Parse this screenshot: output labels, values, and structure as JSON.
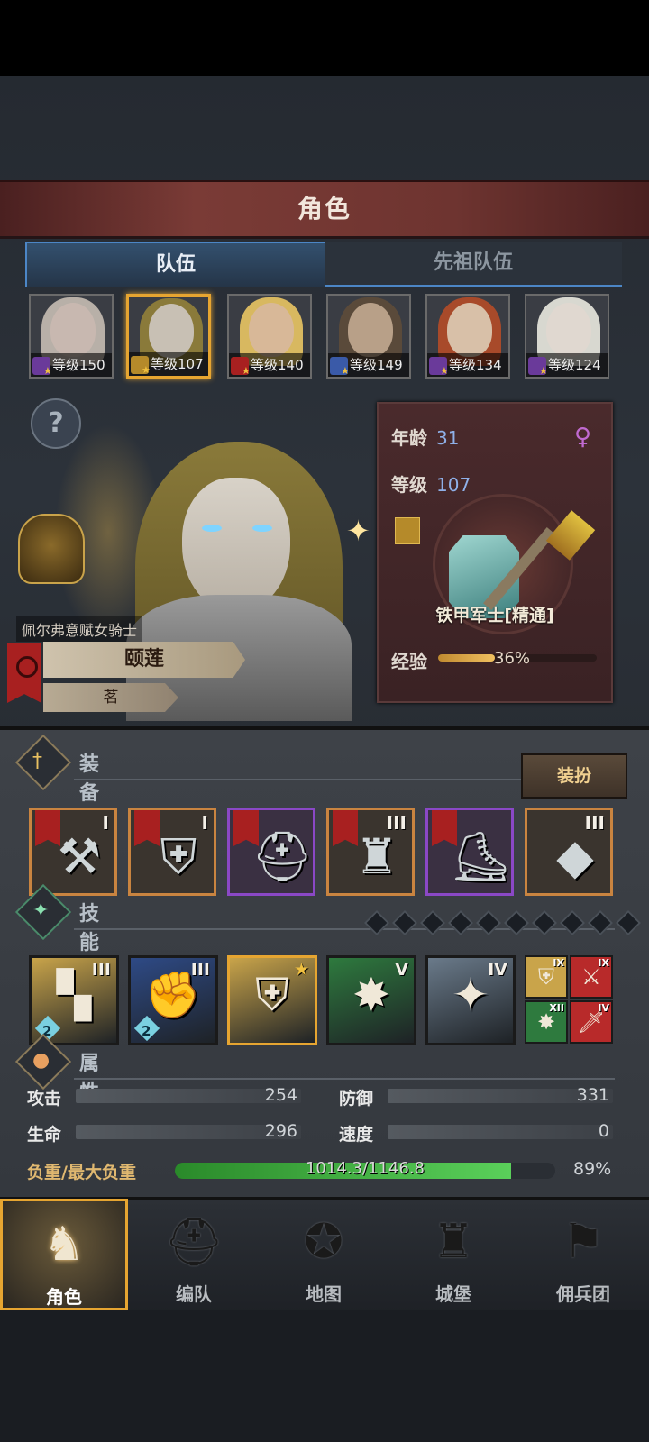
{
  "header": {
    "title": "角色"
  },
  "tabs": [
    {
      "label": "队伍",
      "active": true
    },
    {
      "label": "先祖队伍",
      "active": false
    }
  ],
  "heroes": [
    {
      "level_text": "等级150",
      "selected": false,
      "hair": "#b8b0a8",
      "face": "#c8b8b0",
      "class_color": "#6a3a9a"
    },
    {
      "level_text": "等级107",
      "selected": true,
      "hair": "#8a7a3a",
      "face": "#c8c0b4",
      "class_color": "#b58a2a"
    },
    {
      "level_text": "等级140",
      "selected": false,
      "hair": "#d8b860",
      "face": "#d8b898",
      "class_color": "#a82020"
    },
    {
      "level_text": "等级149",
      "selected": false,
      "hair": "#5a4a3a",
      "face": "#b8a088",
      "class_color": "#3a5aa8"
    },
    {
      "level_text": "等级134",
      "selected": false,
      "hair": "#a84a2a",
      "face": "#d8c0a8",
      "class_color": "#6a3a9a"
    },
    {
      "level_text": "等级124",
      "selected": false,
      "hair": "#d8d8d0",
      "face": "#e0d8d0",
      "class_color": "#6a3a9a"
    }
  ],
  "character": {
    "title": "佩尔弗意赋女骑士",
    "name": "颐莲",
    "tag": "茗",
    "age_label": "年龄",
    "age": "31",
    "level_label": "等级",
    "level": "107",
    "job": "铁甲军士[精通]",
    "exp_label": "经验",
    "exp_pct_text": "36%",
    "exp_fraction": 0.36
  },
  "equipment": {
    "title": "装备",
    "dress_button": "装扮",
    "items": [
      {
        "name": "war-hammer",
        "rank": "I",
        "border": "orange",
        "flag": true,
        "glyph": "⚒"
      },
      {
        "name": "teal-shield",
        "rank": "I",
        "border": "orange",
        "flag": true,
        "glyph": "⛨"
      },
      {
        "name": "knight-helmet",
        "rank": "",
        "border": "purple",
        "flag": true,
        "glyph": "⛑"
      },
      {
        "name": "plate-armor",
        "rank": "III",
        "border": "orange",
        "flag": true,
        "glyph": "♜"
      },
      {
        "name": "plate-boots",
        "rank": "",
        "border": "purple",
        "flag": true,
        "glyph": "⛸"
      },
      {
        "name": "emerald-charm",
        "rank": "III",
        "border": "orange",
        "flag": false,
        "glyph": "◆"
      }
    ]
  },
  "skills": {
    "title": "技能",
    "slots_count": 10,
    "main": [
      {
        "name": "skill-wall",
        "rank": "III",
        "bg": "#c9a44a",
        "glyph": "▚",
        "badge": "2",
        "border": "#1a1a1a"
      },
      {
        "name": "skill-strike",
        "rank": "III",
        "bg": "#2e4a86",
        "glyph": "✊",
        "badge": "2",
        "border": "#1a1a1a"
      },
      {
        "name": "skill-shield-strength",
        "rank": "",
        "bg": "#c9a44a",
        "glyph": "⛨",
        "badge": "",
        "border": "#e6a531"
      },
      {
        "name": "skill-crystal-burst",
        "rank": "V",
        "bg": "#2e7a3e",
        "glyph": "✸",
        "badge": "",
        "border": "#1a1a1a"
      },
      {
        "name": "skill-crystal-fist",
        "rank": "IV",
        "bg": "#6a7a8a",
        "glyph": "✦",
        "badge": "",
        "border": "#1a1a1a"
      }
    ],
    "mini": [
      {
        "name": "mini-skill-fortify",
        "rank": "IX",
        "bg": "#c9a44a",
        "glyph": "⛨"
      },
      {
        "name": "mini-skill-power",
        "rank": "IX",
        "bg": "#b82a2a",
        "glyph": "⚔"
      },
      {
        "name": "mini-skill-burst",
        "rank": "XII",
        "bg": "#2e7a3e",
        "glyph": "✸"
      },
      {
        "name": "mini-skill-blade",
        "rank": "IV",
        "bg": "#b82a2a",
        "glyph": "🗡"
      }
    ]
  },
  "attributes": {
    "title": "属性",
    "attack_label": "攻击",
    "attack": "254",
    "defense_label": "防御",
    "defense": "331",
    "hp_label": "生命",
    "hp": "296",
    "speed_label": "速度",
    "speed": "0",
    "load_label": "负重/最大负重",
    "load_text": "1014.3/1146.8",
    "load_pct_text": "89%",
    "load_fraction": 0.884
  },
  "nav": [
    {
      "label": "角色",
      "icon": "knight-icon",
      "glyph": "♞",
      "active": true
    },
    {
      "label": "编队",
      "icon": "helmet-icon",
      "glyph": "⛑",
      "active": false
    },
    {
      "label": "地图",
      "icon": "compass-map-icon",
      "glyph": "✪",
      "active": false
    },
    {
      "label": "城堡",
      "icon": "castle-icon",
      "glyph": "♜",
      "active": false
    },
    {
      "label": "佣兵团",
      "icon": "mercenary-banner-icon",
      "glyph": "⚑",
      "active": false
    }
  ]
}
